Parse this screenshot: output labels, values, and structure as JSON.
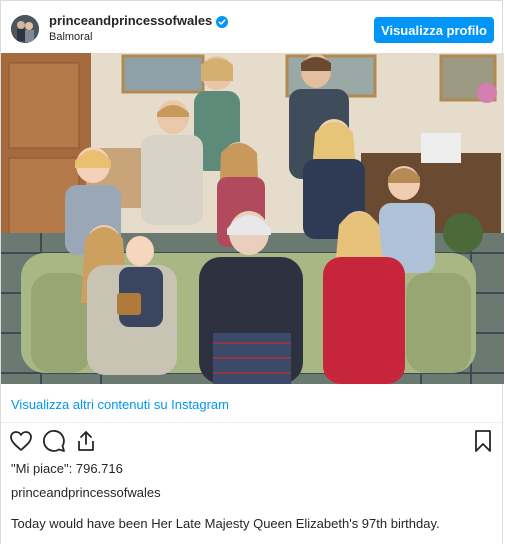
{
  "post": {
    "username": "princeandprincessofwales",
    "location": "Balmoral",
    "profile_button": "Visualizza profilo",
    "more_on_instagram": "Visualizza altri contenuti su Instagram",
    "likes_label": "\"Mi piace\": 796.716",
    "caption_username": "princeandprincessofwales",
    "caption_text": "Today would have been Her Late Majesty Queen Elizabeth's 97th birthday."
  },
  "icons": {
    "verified": "verified-badge-icon",
    "like": "heart-icon",
    "comment": "comment-bubble-icon",
    "share": "share-icon",
    "save": "bookmark-icon"
  },
  "colors": {
    "accent": "#0095f6",
    "text": "#262626",
    "border": "#dbdbdb"
  }
}
